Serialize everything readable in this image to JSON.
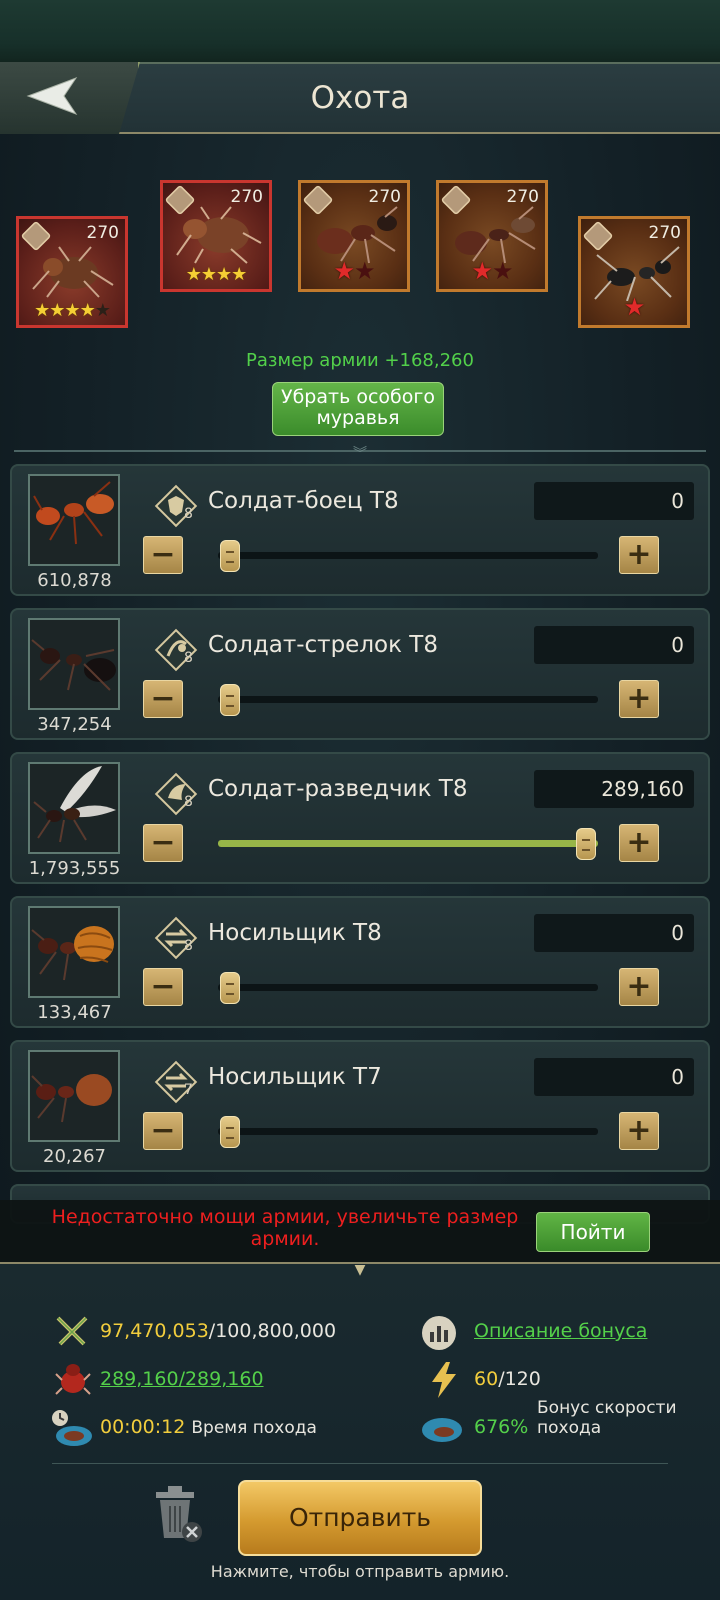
{
  "header": {
    "title": "Охота"
  },
  "special_ants": [
    {
      "level": "270",
      "frame": "red",
      "stars": "★★★★",
      "star_off": "★"
    },
    {
      "level": "270",
      "frame": "red",
      "stars": "★★★★",
      "star_off": ""
    },
    {
      "level": "270",
      "frame": "bronze",
      "stars": "★",
      "star_off": "★"
    },
    {
      "level": "270",
      "frame": "bronze",
      "stars": "★",
      "star_off": "★"
    },
    {
      "level": "270",
      "frame": "bronze",
      "stars": "★",
      "star_off": ""
    }
  ],
  "army_size_text": "Размер армии +168,260",
  "remove_special_ant_button": "Убрать особого муравья",
  "troops": [
    {
      "name": "Солдат-боец T8",
      "tier": "8",
      "count": "610,878",
      "value": "0",
      "fill_fraction": 0
    },
    {
      "name": "Солдат-стрелок T8",
      "tier": "8",
      "count": "347,254",
      "value": "0",
      "fill_fraction": 0
    },
    {
      "name": "Солдат-разведчик T8",
      "tier": "8",
      "count": "1,793,555",
      "value": "289,160",
      "fill_fraction": 1
    },
    {
      "name": "Носильщик T8",
      "tier": "8",
      "count": "133,467",
      "value": "0",
      "fill_fraction": 0
    },
    {
      "name": "Носильщик T7",
      "tier": "7",
      "count": "20,267",
      "value": "0",
      "fill_fraction": 0
    }
  ],
  "warning": {
    "text": "Недостаточно мощи армии, увеличьте размер армии.",
    "go_button": "Пойти"
  },
  "stats": {
    "power_current": "97,470,053",
    "power_max": "/100,800,000",
    "bonus_link": "Описание бонуса",
    "troops_link": "289,160/289,160",
    "energy_current": "60",
    "energy_max": "/120",
    "march_time": "00:00:12",
    "march_time_label": "Время похода",
    "speed_bonus": "676%",
    "speed_bonus_label": "Бонус скорости похода"
  },
  "send_button": "Отправить",
  "send_hint": "Нажмите, чтобы отправить армию.",
  "colors": {
    "accent_green": "#54d04a",
    "warning_red": "#ee1f1f",
    "gold": "#f2cd3d"
  }
}
